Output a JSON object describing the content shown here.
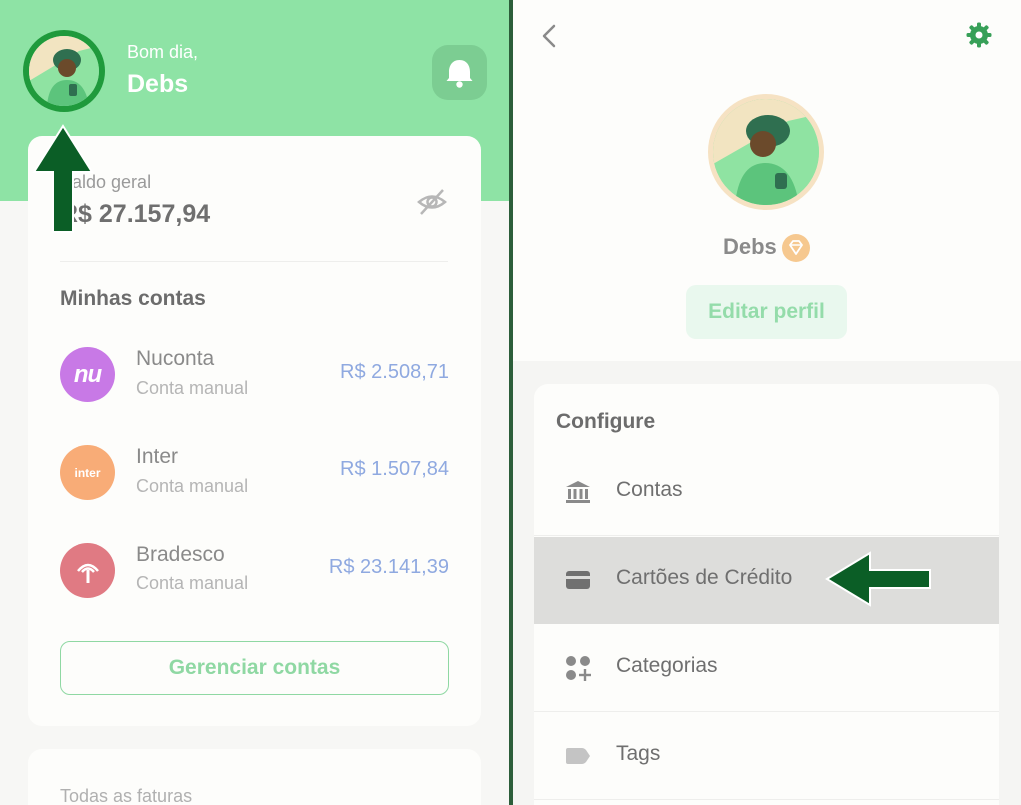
{
  "left": {
    "greeting": "Bom dia,",
    "user_name": "Debs",
    "balance": {
      "label": "Saldo geral",
      "value": "R$ 27.157,94"
    },
    "accounts_title": "Minhas contas",
    "accounts": [
      {
        "icon_text": "nu",
        "name": "Nuconta",
        "sub": "Conta manual",
        "value": "R$ 2.508,71",
        "color": "#c879e6"
      },
      {
        "icon_text": "inter",
        "name": "Inter",
        "sub": "Conta manual",
        "value": "R$ 1.507,84",
        "color": "#f8ac77"
      },
      {
        "icon_text": "",
        "name": "Bradesco",
        "sub": "Conta manual",
        "value": "R$ 23.141,39",
        "color": "#e07a83"
      }
    ],
    "manage_button": "Gerenciar contas",
    "faturas_label": "Todas as faturas"
  },
  "right": {
    "profile_name": "Debs",
    "edit_button": "Editar perfil",
    "configure_title": "Configure",
    "menu": [
      {
        "icon": "bank-icon",
        "label": "Contas"
      },
      {
        "icon": "credit-card-icon",
        "label": "Cartões de Crédito"
      },
      {
        "icon": "categories-icon",
        "label": "Categorias"
      },
      {
        "icon": "tag-icon",
        "label": "Tags"
      }
    ]
  },
  "colors": {
    "header_green": "#8ee3a5",
    "arrow_green": "#0b5e26",
    "accent_blue": "#8fa9e0",
    "highlight_row": "#dddddb"
  }
}
